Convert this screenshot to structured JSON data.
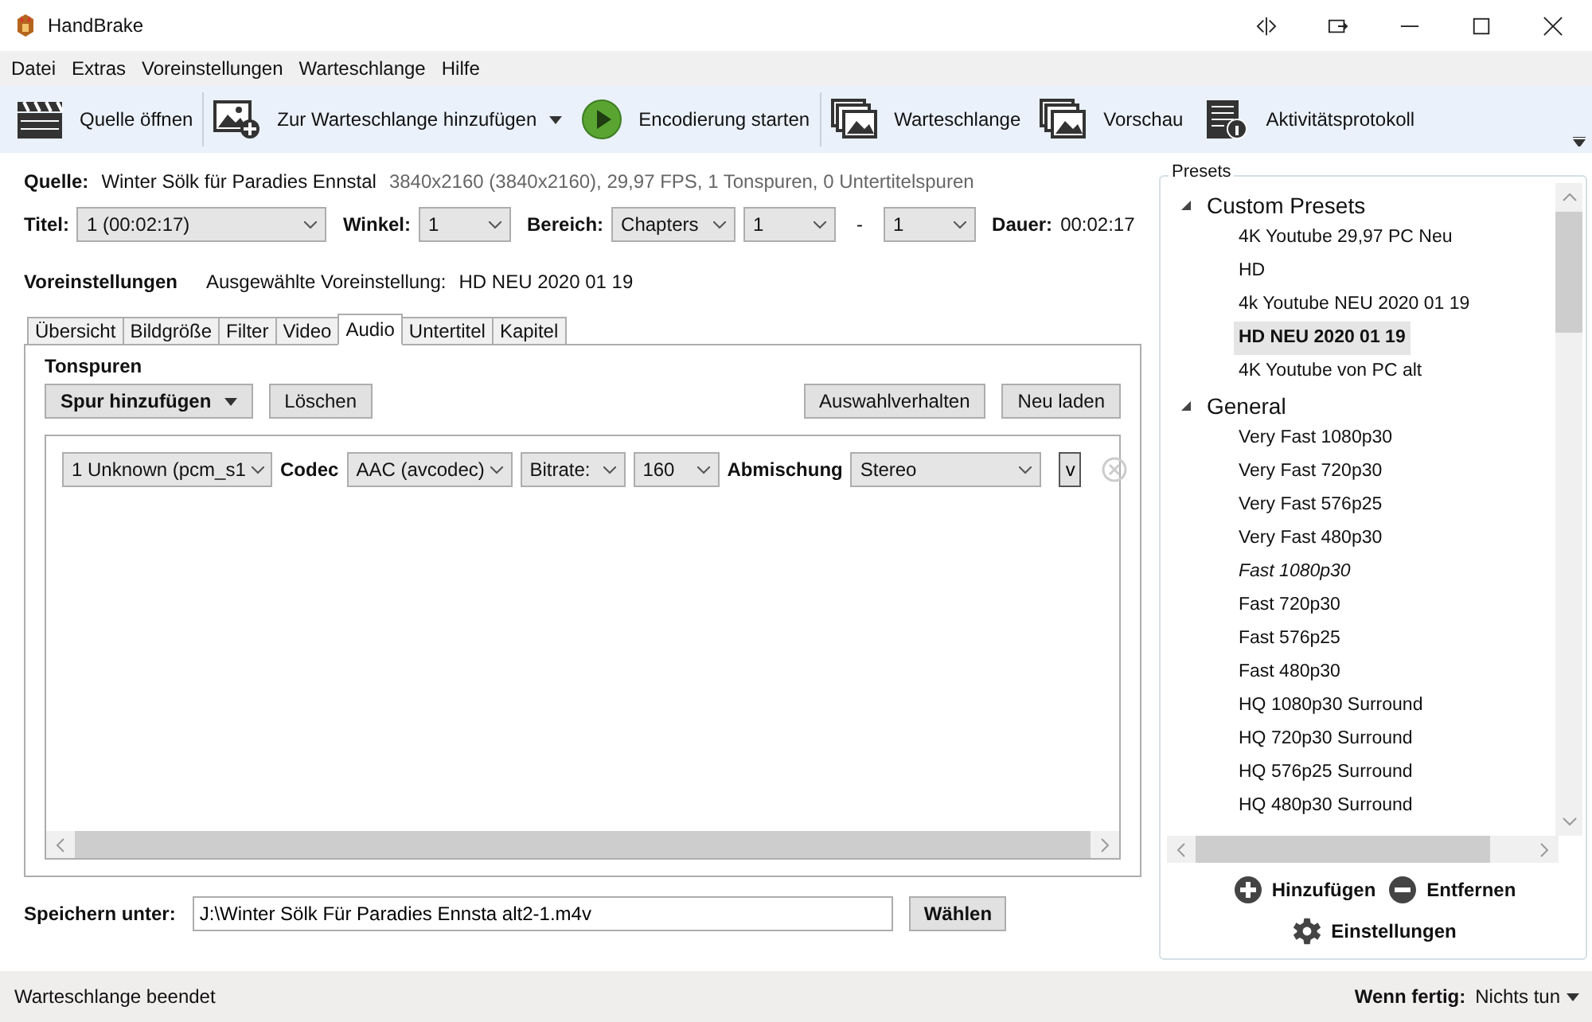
{
  "window": {
    "title": "HandBrake"
  },
  "menu": [
    "Datei",
    "Extras",
    "Voreinstellungen",
    "Warteschlange",
    "Hilfe"
  ],
  "toolbar": [
    {
      "label": "Quelle öffnen",
      "kind": "clapper",
      "dropdown": false
    },
    {
      "label": "Zur Warteschlange hinzufügen",
      "kind": "add-image",
      "dropdown": true
    },
    {
      "label": "Encodierung starten",
      "kind": "play",
      "dropdown": false
    },
    {
      "label": "Warteschlange",
      "kind": "images",
      "dropdown": false
    },
    {
      "label": "Vorschau",
      "kind": "images",
      "dropdown": false
    },
    {
      "label": "Aktivitätsprotokoll",
      "kind": "log",
      "dropdown": false
    }
  ],
  "source": {
    "label": "Quelle:",
    "name": "Winter Sölk für Paradies Ennstal",
    "info": "3840x2160 (3840x2160), 29,97 FPS, 1 Tonspuren, 0 Untertitelspuren"
  },
  "title_row": {
    "title_label": "Titel:",
    "title": "1 (00:02:17)",
    "angle_label": "Winkel:",
    "angle": "1",
    "range_label": "Bereich:",
    "range_kind": "Chapters",
    "range_from": "1",
    "range_sep": "-",
    "range_to": "1",
    "duration_label": "Dauer:",
    "duration": "00:02:17"
  },
  "preset_line": {
    "label": "Voreinstellungen",
    "text": "Ausgewählte Voreinstellung:",
    "value": "HD NEU 2020 01 19"
  },
  "tabs": [
    {
      "label": "Übersicht",
      "selected": false
    },
    {
      "label": "Bildgröße",
      "selected": false
    },
    {
      "label": "Filter",
      "selected": false
    },
    {
      "label": "Video",
      "selected": false
    },
    {
      "label": "Audio",
      "selected": true
    },
    {
      "label": "Untertitel",
      "selected": false
    },
    {
      "label": "Kapitel",
      "selected": false
    }
  ],
  "audio": {
    "heading": "Tonspuren",
    "add_button": "Spur hinzufügen",
    "delete_button": "Löschen",
    "behavior_button": "Auswahlverhalten",
    "reload_button": "Neu laden",
    "tracks": [
      {
        "track": "1 Unknown (pcm_s1",
        "codec_label": "Codec",
        "codec": "AAC (avcodec)",
        "bitrate_mode": "Bitrate:",
        "bitrate": "160",
        "mix_label": "Abmischung",
        "mix": "Stereo",
        "more": "v"
      }
    ]
  },
  "save": {
    "label": "Speichern unter:",
    "value": "J:\\Winter Sölk Für Paradies Ennsta alt2-1.m4v",
    "button": "Wählen"
  },
  "presets": {
    "title": "Presets",
    "groups": [
      {
        "name": "Custom Presets",
        "expanded": true,
        "children": [
          {
            "name": "4K Youtube 29,97 PC Neu",
            "selected": false,
            "default": false
          },
          {
            "name": "HD",
            "selected": false,
            "default": false
          },
          {
            "name": "4k Youtube NEU 2020 01 19",
            "selected": false,
            "default": false
          },
          {
            "name": "HD NEU 2020 01 19",
            "selected": true,
            "default": false
          },
          {
            "name": "4K Youtube von PC alt",
            "selected": false,
            "default": false
          }
        ]
      },
      {
        "name": "General",
        "expanded": true,
        "children": [
          {
            "name": "Very Fast 1080p30",
            "selected": false,
            "default": false
          },
          {
            "name": "Very Fast 720p30",
            "selected": false,
            "default": false
          },
          {
            "name": "Very Fast 576p25",
            "selected": false,
            "default": false
          },
          {
            "name": "Very Fast 480p30",
            "selected": false,
            "default": false
          },
          {
            "name": "Fast 1080p30",
            "selected": false,
            "default": true
          },
          {
            "name": "Fast 720p30",
            "selected": false,
            "default": false
          },
          {
            "name": "Fast 576p25",
            "selected": false,
            "default": false
          },
          {
            "name": "Fast 480p30",
            "selected": false,
            "default": false
          },
          {
            "name": "HQ 1080p30 Surround",
            "selected": false,
            "default": false
          },
          {
            "name": "HQ 720p30 Surround",
            "selected": false,
            "default": false
          },
          {
            "name": "HQ 576p25 Surround",
            "selected": false,
            "default": false
          },
          {
            "name": "HQ 480p30 Surround",
            "selected": false,
            "default": false
          }
        ]
      }
    ],
    "add": "Hinzufügen",
    "remove": "Entfernen",
    "settings": "Einstellungen"
  },
  "status_bar": {
    "text": "Warteschlange beendet",
    "when_done_label": "Wenn fertig:",
    "when_done": "Nichts tun"
  }
}
